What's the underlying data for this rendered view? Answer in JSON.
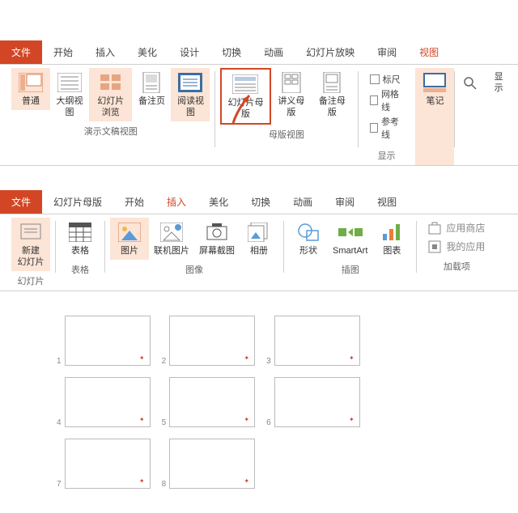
{
  "ribbon1": {
    "tabs": [
      "文件",
      "开始",
      "插入",
      "美化",
      "设计",
      "切换",
      "动画",
      "幻灯片放映",
      "审阅",
      "视图"
    ],
    "activeTab": "视图",
    "group_presentation": {
      "label": "演示文稿视图",
      "normal": "普通",
      "outline": "大纲视图",
      "sorter": "幻灯片浏览",
      "notes": "备注页",
      "reading": "阅读视图"
    },
    "group_master": {
      "label": "母版视图",
      "slide_master": "幻灯片母版",
      "handout_master": "讲义母版",
      "notes_master": "备注母版"
    },
    "group_show": {
      "label": "显示",
      "ruler": "标尺",
      "gridlines": "网格线",
      "guides": "参考线"
    },
    "notes_btn": "笔记",
    "zoom_btn": "显示"
  },
  "ribbon2": {
    "tabs": [
      "文件",
      "幻灯片母版",
      "开始",
      "插入",
      "美化",
      "切换",
      "动画",
      "审阅",
      "视图"
    ],
    "activeTab": "插入",
    "group_slide": {
      "label": "幻灯片",
      "new_slide": "新建\n幻灯片"
    },
    "group_table": {
      "label": "表格",
      "table": "表格"
    },
    "group_image": {
      "label": "图像",
      "picture": "图片",
      "online_pic": "联机图片",
      "screenshot": "屏幕截图",
      "album": "相册"
    },
    "group_illust": {
      "label": "插图",
      "shapes": "形状",
      "smartart": "SmartArt",
      "chart": "图表"
    },
    "group_addins": {
      "label": "加载项",
      "store": "应用商店",
      "myaddins": "我的应用"
    }
  },
  "thumbs": [
    1,
    2,
    3,
    4,
    5,
    6,
    7,
    8
  ]
}
